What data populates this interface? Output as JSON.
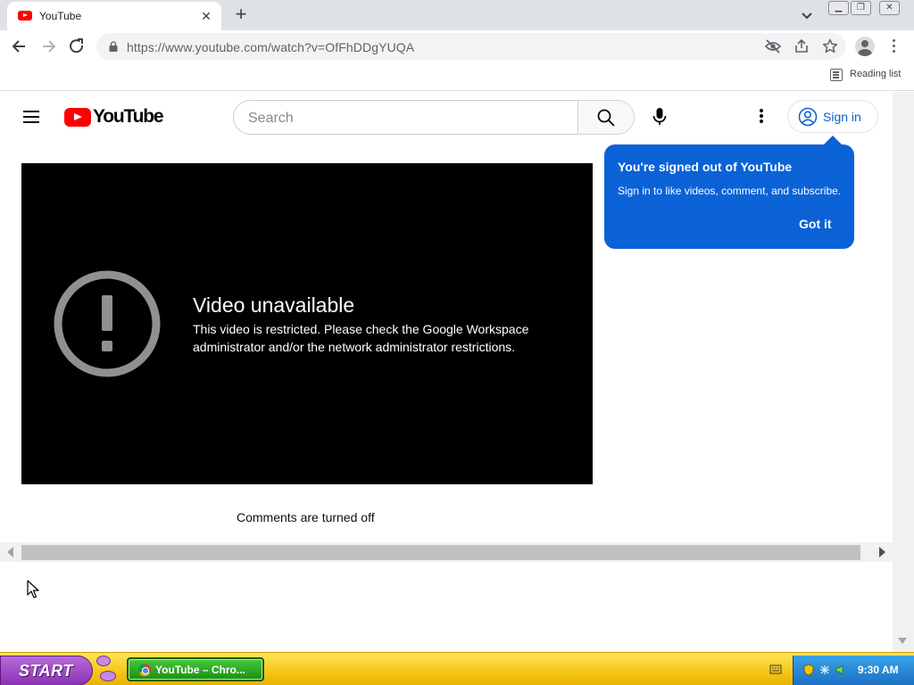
{
  "browser": {
    "tab_title": "YouTube",
    "url": "https://www.youtube.com/watch?v=OfFhDDgYUQA",
    "reading_list_label": "Reading list"
  },
  "youtube": {
    "wordmark": "YouTube",
    "search_placeholder": "Search",
    "signin_label": "Sign in",
    "popup": {
      "title": "You're signed out of YouTube",
      "body": "Sign in to like videos, comment, and subscribe.",
      "button": "Got it"
    },
    "player": {
      "error_title": "Video unavailable",
      "error_body": "This video is restricted. Please check the Google Workspace administrator and/or the network administrator restrictions."
    },
    "comments_status": "Comments are turned off"
  },
  "taskbar": {
    "start_label": "START",
    "task_label": "YouTube – Chro...",
    "clock": "9:30 AM"
  },
  "colors": {
    "youtube_red": "#ff0000",
    "popup_blue": "#0b62d6",
    "signin_blue": "#065fd4"
  }
}
